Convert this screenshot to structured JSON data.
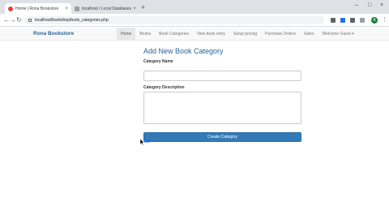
{
  "browser": {
    "tabs": [
      {
        "title": "Home | Rona Bookstore",
        "favicon_color": "#e8403f"
      },
      {
        "title": "localhost / Local Databases / lo...",
        "favicon_color": "#9aa0a6"
      }
    ],
    "new_tab_symbol": "+",
    "close_symbol": "×",
    "window_controls": [
      "–",
      "□",
      "×"
    ],
    "nav": {
      "back": "←",
      "forward": "→",
      "reload": "↻"
    },
    "url": "localhost/bookshop/book_categories.php",
    "profile_initial": "A",
    "menu_symbol": "⋮",
    "extension_colors": [
      "#5f6368",
      "#1a73e8",
      "#5f6368",
      "#9aa0a6"
    ]
  },
  "navbar": {
    "brand": "Rona Bookstore",
    "items": [
      {
        "label": "Home",
        "active": true
      },
      {
        "label": "Books",
        "active": false
      },
      {
        "label": "Book Categories",
        "active": false
      },
      {
        "label": "New book entry",
        "active": false
      },
      {
        "label": "Setup pricing",
        "active": false
      },
      {
        "label": "Purchase Orders",
        "active": false
      },
      {
        "label": "Sales",
        "active": false
      },
      {
        "label": "Welcome Guest ▾",
        "active": false
      }
    ]
  },
  "form": {
    "title": "Add New Book Category",
    "category_name_label": "Category Name",
    "category_name_value": "",
    "category_description_label": "Category Description",
    "category_description_value": "",
    "submit_label": "Create Category"
  },
  "colors": {
    "brand": "#2a6496",
    "primary_button": "#337ab7"
  }
}
